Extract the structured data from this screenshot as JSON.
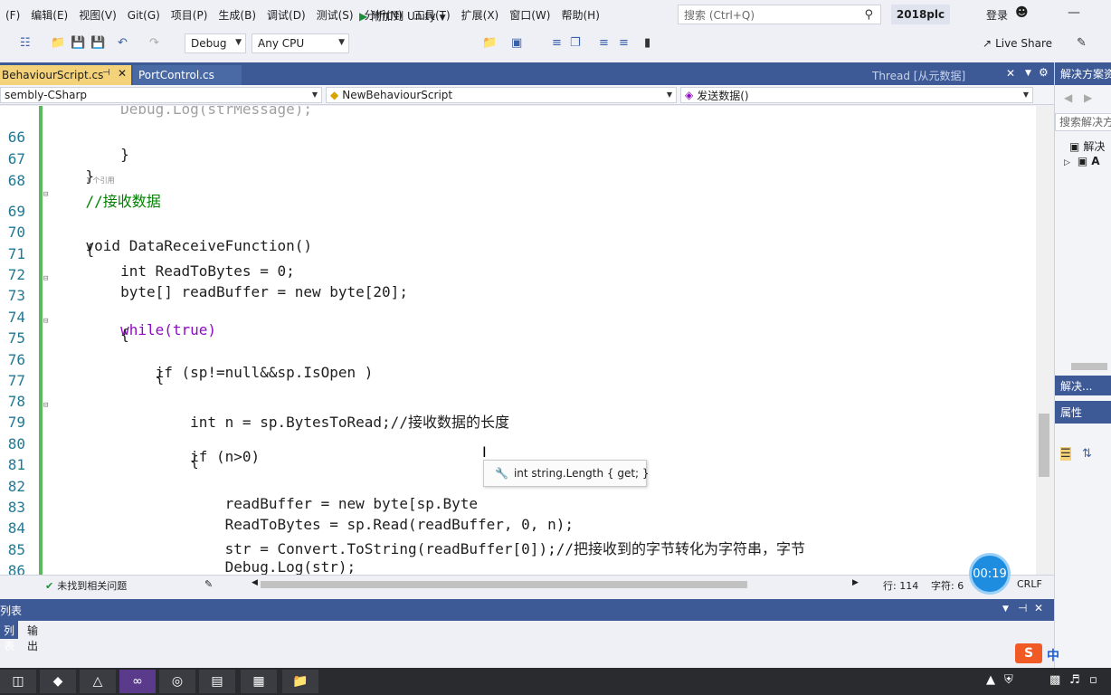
{
  "menu": {
    "items": [
      "(F)",
      "编辑(E)",
      "视图(V)",
      "Git(G)",
      "项目(P)",
      "生成(B)",
      "调试(D)",
      "测试(S)",
      "分析(N)",
      "工具(T)",
      "扩展(X)",
      "窗口(W)",
      "帮助(H)"
    ],
    "search_placeholder": "搜索 (Ctrl+Q)",
    "solution_name": "2018plc",
    "login_label": "登录"
  },
  "toolbar": {
    "config_value": "Debug",
    "platform_value": "Any CPU",
    "attach_label": "附加到 Unity",
    "live_share_label": "Live Share"
  },
  "tabs": {
    "active_label": "BehaviourScript.cs",
    "inactive_label": "PortControl.cs",
    "thread_label": "Thread [从元数据]"
  },
  "navbar": {
    "project": "sembly-CSharp",
    "class": "NewBehaviourScript",
    "member": "发送数据()"
  },
  "editor": {
    "ref_hint": "1 个引用",
    "lines": [
      {
        "n": "66",
        "code": "        }"
      },
      {
        "n": "67",
        "code": "    }"
      },
      {
        "n": "68",
        "code": "    //接收数据"
      },
      {
        "n": "69",
        "code": "    void DataReceiveFunction()"
      },
      {
        "n": "70",
        "code": "    {"
      },
      {
        "n": "71",
        "code": "        int ReadToBytes = 0;"
      },
      {
        "n": "72",
        "code": "        byte[] readBuffer = new byte[20];"
      },
      {
        "n": "73",
        "code": "        while(true)"
      },
      {
        "n": "74",
        "code": "        {"
      },
      {
        "n": "75",
        "code": "            if (sp!=null&&sp.IsOpen )"
      },
      {
        "n": "76",
        "code": "            {"
      },
      {
        "n": "77",
        "code": ""
      },
      {
        "n": "78",
        "code": "                int n = sp.BytesToRead;//接收数据的长度"
      },
      {
        "n": "79",
        "code": "                if (n>0)"
      },
      {
        "n": "80",
        "code": "                {"
      },
      {
        "n": "81",
        "code": ""
      },
      {
        "n": "82",
        "code": "                    readBuffer = new byte[sp.Byte"
      },
      {
        "n": "83",
        "code": "                    ReadToBytes = sp.Read(readBuffer, 0, n);"
      },
      {
        "n": "84",
        "code": "                    str = Convert.ToString(readBuffer[0]);//把接收到的字节转化为字符串，字节"
      },
      {
        "n": "85",
        "code": "                    Debug.Log(str);"
      },
      {
        "n": "86",
        "code": "                }"
      }
    ],
    "tooltip": "int string.Length { get; }"
  },
  "status": {
    "issues": "未找到相关问题",
    "line": "行: 114",
    "char": "字符: 6",
    "eol": "CRLF",
    "timer": "00:19"
  },
  "bottom_panel": {
    "title": "列表",
    "tab_list": "列表",
    "tab_output": "输出"
  },
  "right_panel": {
    "title": "解决方案资",
    "search": "搜索解决方",
    "item1": "解决",
    "item2": "A",
    "tab_short": "解决...",
    "props_title": "属性"
  },
  "ime": {
    "badge": "S",
    "lang": "中"
  }
}
